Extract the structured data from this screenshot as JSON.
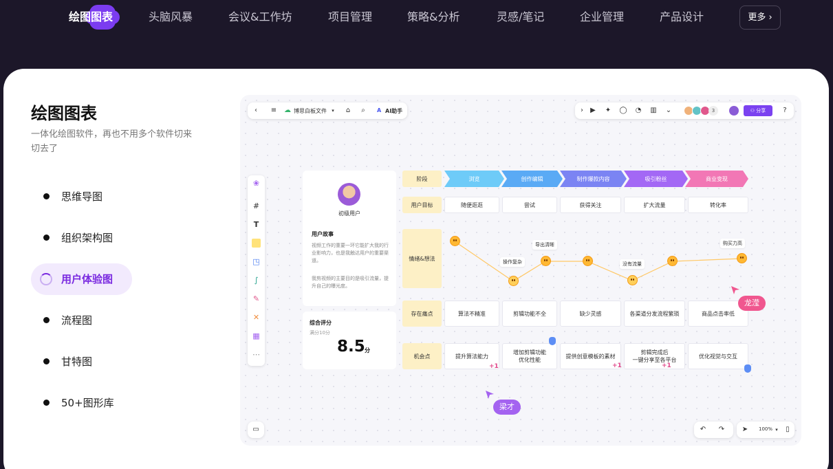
{
  "nav": {
    "active": "绘图图表",
    "items": [
      "头脑风暴",
      "会议&工作坊",
      "项目管理",
      "策略&分析",
      "灵感/笔记",
      "企业管理",
      "产品设计"
    ],
    "more": "更多"
  },
  "section": {
    "title": "绘图图表",
    "subtitle": "一体化绘图软件，再也不用多个软件切来切去了",
    "menu": [
      "思维导图",
      "组织架构图",
      "用户体验图",
      "流程图",
      "甘特图",
      "50+图形库"
    ],
    "active_menu_index": 2
  },
  "board": {
    "file_name": "博思白板文件",
    "ai_label": "AI助手",
    "share_label": "分享",
    "avatar_count": "3",
    "zoom": "100%",
    "persona": {
      "role": "初级用户",
      "story_title": "用户故事",
      "story_p1": "视频工作的重要一环它能扩大我的行业影响力，也是我触达用户的重要渠道。",
      "story_p2": "我剪视频的主要目的是吸引流量，提升自己的曝光度。"
    },
    "score": {
      "title": "综合评分",
      "sub": "满分10分",
      "value": "8.5",
      "unit": "分"
    },
    "row_labels": [
      "阶段",
      "用户目标",
      "情绪&想法",
      "存在痛点",
      "机会点"
    ],
    "stages": [
      {
        "label": "浏览",
        "color": "#6ecbf8"
      },
      {
        "label": "创作编辑",
        "color": "#5aaaf5"
      },
      {
        "label": "制作爆款内容",
        "color": "#7b84f3"
      },
      {
        "label": "吸引粉丝",
        "color": "#a368f5"
      },
      {
        "label": "商业变现",
        "color": "#f277b5"
      }
    ],
    "goals": [
      "随便逛逛",
      "尝试",
      "获得关注",
      "扩大流量",
      "转化率"
    ],
    "emotions": [
      "导出清晰",
      "操作复杂",
      "没有流量",
      "购买力高"
    ],
    "pains": [
      "算法不精准",
      "剪辑功能不全",
      "缺少灵感",
      "各渠道分发流程繁琐",
      "商品点击率低"
    ],
    "opportunities": [
      "提升算法能力",
      "增加剪辑功能\n优化性能",
      "提供创意模板的素材",
      "剪辑完成后\n一键分享至各平台",
      "优化视觉与交互"
    ],
    "plus_label": "+1",
    "cursors": [
      {
        "name": "龙滢",
        "color": "#f0578f"
      },
      {
        "name": "梁才",
        "color": "#a463f0"
      }
    ]
  }
}
